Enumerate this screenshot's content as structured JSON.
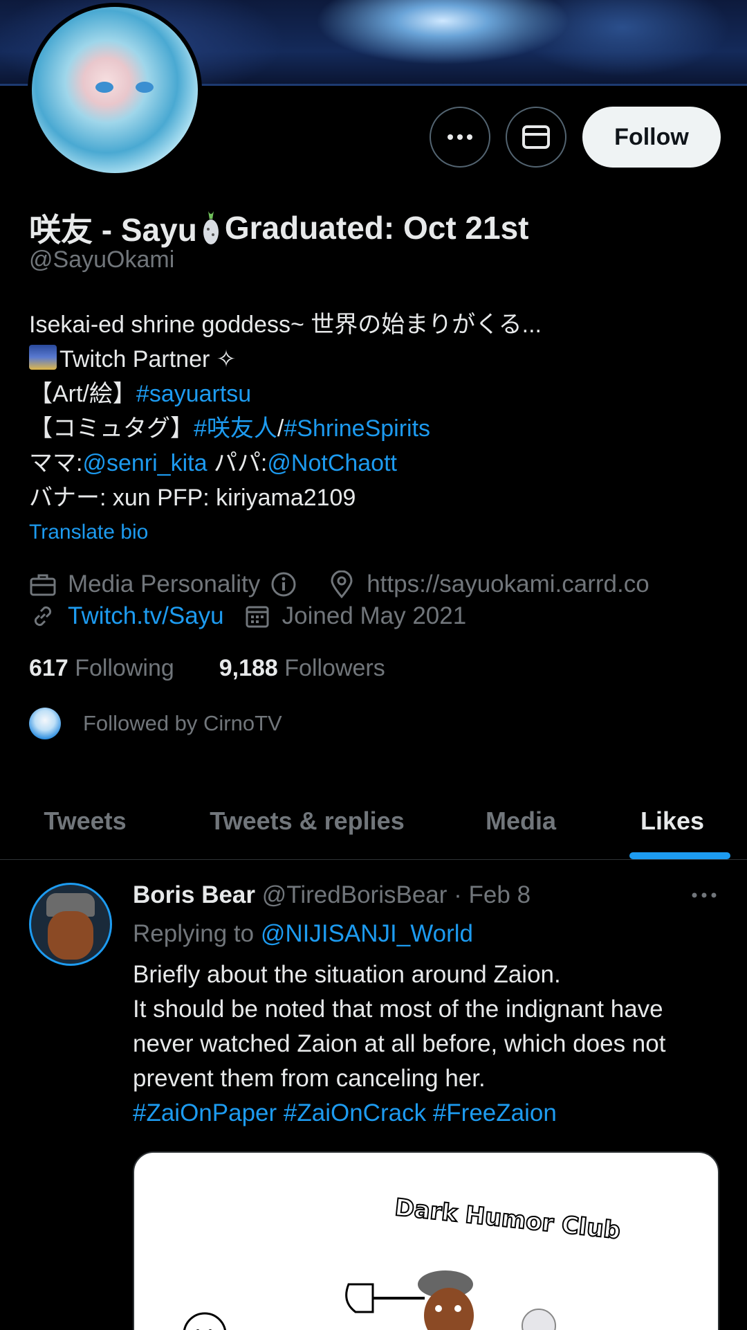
{
  "profile": {
    "display_name_part1": "咲友 - Sayu",
    "display_name_part2": "Graduated: Oct 21st",
    "handle": "@SayuOkami",
    "bio_line1": "Isekai-ed shrine goddess~ 世界の始まりがくる...",
    "bio_line2": "Twitch Partner ✧",
    "bio_line3_prefix": "【Art/絵】",
    "bio_line3_link": "#sayuartsu",
    "bio_line4_prefix": "【コミュタグ】",
    "bio_line4_link1": "#咲友人",
    "bio_line4_sep": "/",
    "bio_line4_link2": "#ShrineSpirits",
    "bio_line5_a": "ママ:",
    "bio_line5_link1": "@senri_kita",
    "bio_line5_b": " パパ:",
    "bio_line5_link2": "@NotChaott",
    "bio_line6": "バナー: xun PFP: kiriyama2109",
    "translate_label": "Translate bio",
    "category": "Media Personality",
    "website": "https://sayuokami.carrd.co",
    "twitch_link": "Twitch.tv/Sayu",
    "joined": "Joined May 2021",
    "following_count": "617",
    "following_label": "Following",
    "followers_count": "9,188",
    "followers_label": "Followers",
    "followed_by": "Followed by CirnoTV"
  },
  "actions": {
    "more_icon": "more-horizontal-icon",
    "message_icon": "envelope-icon",
    "follow_label": "Follow"
  },
  "tabs": [
    {
      "label": "Tweets",
      "active": false
    },
    {
      "label": "Tweets & replies",
      "active": false
    },
    {
      "label": "Media",
      "active": false
    },
    {
      "label": "Likes",
      "active": true
    }
  ],
  "tweet": {
    "author_name": "Boris Bear",
    "author_handle": "@TiredBorisBear",
    "date": "· Feb 8",
    "replying_prefix": "Replying to ",
    "replying_to": "@NIJISANJI_World",
    "text_line1": "Briefly about the situation around Zaion.",
    "text_line2": "It should be noted that most of the indignant have",
    "text_line3": "never watched Zaion at all before, which does not",
    "text_line4": "prevent them from canceling her.",
    "hashtag1": "#ZaiOnPaper",
    "hashtag2": "#ZaiOnCrack",
    "hashtag3": "#FreeZaion",
    "media_caption": "Dark Humor Club"
  },
  "colors": {
    "background": "#000000",
    "text": "#e7e9ea",
    "muted": "#71767b",
    "accent": "#1d9bf0",
    "follow_bg": "#eff3f4"
  }
}
